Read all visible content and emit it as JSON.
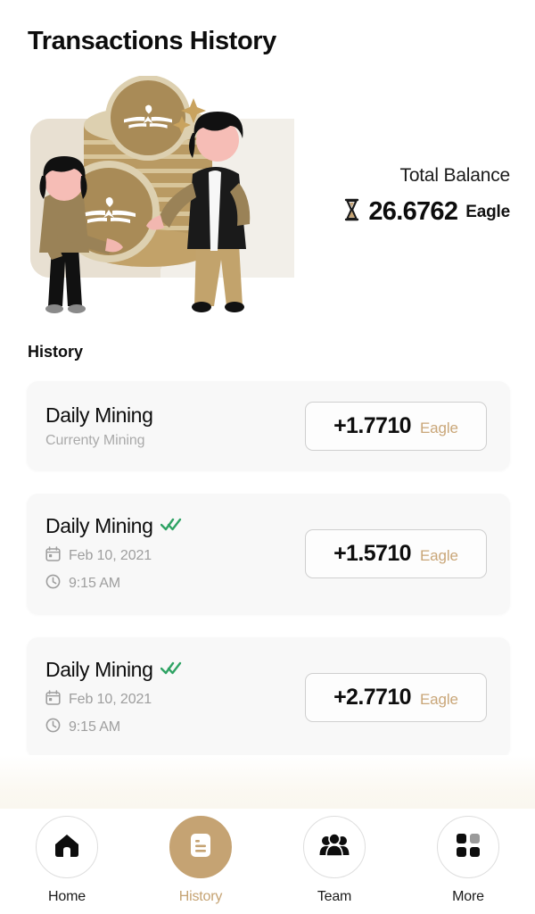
{
  "header": {
    "title": "Transactions History"
  },
  "balance": {
    "label": "Total Balance",
    "amount": "26.6762",
    "currency": "Eagle",
    "icon": "hourglass-icon"
  },
  "illustration": {
    "name": "people-with-coin-stack-illustration",
    "backdrop_color": "#e8e0d2",
    "coin_color": "#a98b57",
    "sparkle_color": "#c9a35f"
  },
  "history": {
    "section_title": "History",
    "items": [
      {
        "title": "Daily Mining",
        "subtitle": "Currenty Mining",
        "verified": false,
        "date": null,
        "time": null,
        "amount": "+1.7710",
        "currency": "Eagle"
      },
      {
        "title": "Daily Mining",
        "subtitle": null,
        "verified": true,
        "date": "Feb 10, 2021",
        "time": "9:15 AM",
        "amount": "+1.5710",
        "currency": "Eagle"
      },
      {
        "title": "Daily Mining",
        "subtitle": null,
        "verified": true,
        "date": "Feb 10, 2021",
        "time": "9:15 AM",
        "amount": "+2.7710",
        "currency": "Eagle"
      }
    ]
  },
  "bottom_nav": {
    "active": "History",
    "items": [
      {
        "label": "Home",
        "icon": "home-icon",
        "active": false
      },
      {
        "label": "History",
        "icon": "document-icon",
        "active": true
      },
      {
        "label": "Team",
        "icon": "people-icon",
        "active": false
      },
      {
        "label": "More",
        "icon": "grid-icon",
        "active": false
      }
    ]
  },
  "colors": {
    "accent": "#c5a373",
    "currency_text": "#c9a678",
    "verified_check": "#2fa364",
    "card_bg": "#f8f8f8",
    "muted_text": "#9e9e9e"
  }
}
